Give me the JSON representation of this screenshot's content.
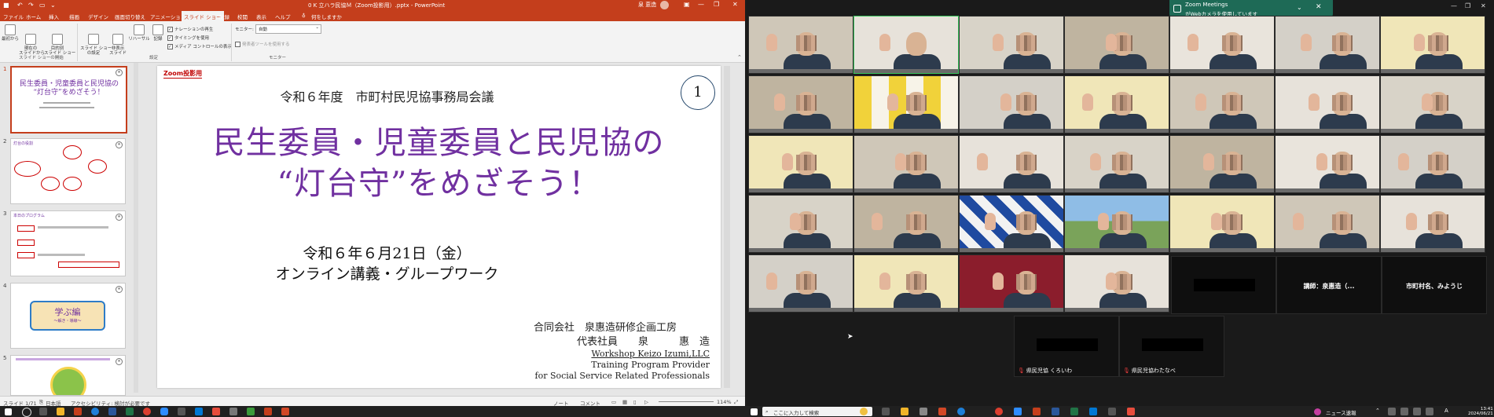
{
  "ppt": {
    "title": "0 K  立ハラ民協Ｍ（Zoom投影用）.pptx  -  PowerPoint",
    "user": "泉 恵造",
    "tabs": [
      "ファイル",
      "ホーム",
      "挿入",
      "描画",
      "デザイン",
      "画面切り替え",
      "アニメーション",
      "スライド ショー",
      "記録",
      "校閲",
      "表示",
      "ヘルプ",
      "何をしますか"
    ],
    "active_tab_index": 7,
    "ribbon": {
      "btn1": "最初から",
      "btn2": "現在の\nスライドから",
      "btn3": "目的別\nスライド ショー",
      "btn4": "スライド ショー\nの設定",
      "btn5": "非表示\nスライド",
      "btn6": "リハーサル",
      "btn7": "記録",
      "cb1": "ナレーションの再生",
      "cb2": "タイミングを使用",
      "cb3": "メディア コントロールの表示",
      "monitor_label": "モニター:",
      "monitor_value": "自動",
      "presenter_view": "発表者ツールを使用する",
      "group1": "スライド ショーの開始",
      "group2": "設定",
      "group3": "モニター"
    },
    "thumbs": [
      {
        "num": "1"
      },
      {
        "num": "2"
      },
      {
        "num": "3"
      },
      {
        "num": "4"
      },
      {
        "num": "5"
      }
    ],
    "thumb_texts": {
      "t1_title": "民生委員・児童委員と民児協の\n“灯台守”をめざそう！",
      "t2_title": "灯台の役割",
      "t3_title": "本日のプログラム",
      "t4_title": "学ぶ編",
      "t4_sub": "〜解き・導線〜"
    },
    "slide": {
      "tag": "Zoom投影用",
      "num": "1",
      "meeting": "令和６年度　市町村民児協事務局会議",
      "title_line1": "民生委員・児童委員と民児協の",
      "title_line2": "“灯台守”をめざそう！",
      "date": "令和６年６月21日（金）",
      "subtitle": "オンライン講義・グループワーク",
      "org": "合同会社　泉惠造研修企画工房",
      "rep": "代表社員　　泉　　　惠　造",
      "en1": "Workshop Keizo Izumi,LLC",
      "en2": "Training Program Provider",
      "en3": "for Social Service Related Professionals"
    },
    "status": {
      "slide_of": "スライド 1/71",
      "lang": "日本語",
      "accessibility": "アクセシビリティ: 検討が必要です",
      "notes": "ノート",
      "comments": "コメント",
      "zoom": "114%"
    }
  },
  "zoom": {
    "notice_title": "Zoom Meetings",
    "notice_text": "がWebカメラを使用しています",
    "names": {
      "speaker": "講師：泉惠造（...",
      "muni": "市町村名、みようじ",
      "kuroiwa": "県民児協 くろいわ",
      "watanabe": "県民児協わたなべ"
    }
  },
  "taskbar": {
    "search_placeholder": "ここに入力して検索",
    "news": "ニュース速報",
    "time": "13:41",
    "date": "2024/06/21"
  },
  "colors": {
    "ppt_accent": "#c43e1c",
    "title_purple": "#7030a0",
    "zoom_green": "#1e6a56"
  }
}
